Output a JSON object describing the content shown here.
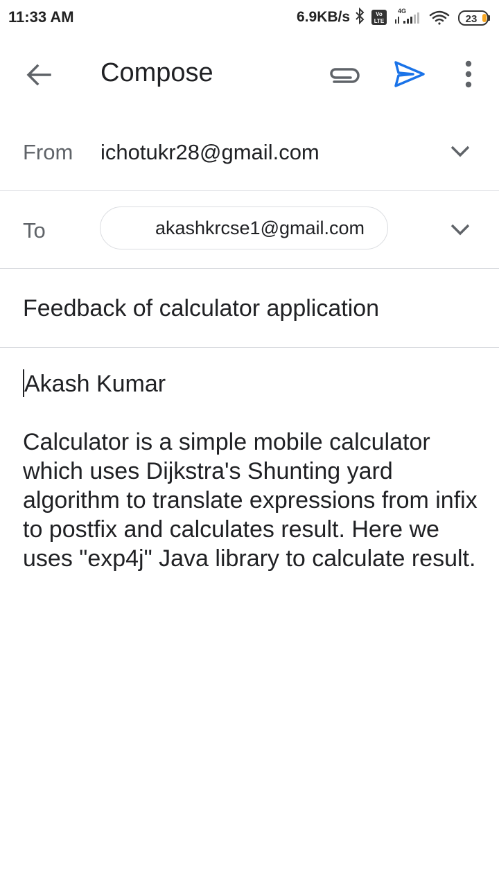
{
  "status_bar": {
    "time": "11:33 AM",
    "net_speed": "6.9KB/s",
    "network_type": "4G",
    "volte_label": "Vo LTE",
    "battery_level": "23",
    "icons": [
      "bluetooth-icon",
      "volte-icon",
      "signal-icon",
      "wifi-icon",
      "battery-icon"
    ]
  },
  "toolbar": {
    "title": "Compose",
    "icons": [
      "back-arrow-icon",
      "attach-icon",
      "send-icon",
      "more-vert-icon"
    ],
    "accent_color": "#1a73e8"
  },
  "from": {
    "label": "From",
    "value": "ichotukr28@gmail.com"
  },
  "to": {
    "label": "To",
    "recipient": "akashkrcse1@gmail.com"
  },
  "subject": "Feedback of calculator application",
  "body": {
    "greeting": "Akash Kumar",
    "text": "Calculator is a simple mobile calculator which uses Dijkstra's Shunting yard algorithm to translate expressions from infix to postfix and calculates result. Here we uses \"exp4j\" Java library to calculate result."
  }
}
